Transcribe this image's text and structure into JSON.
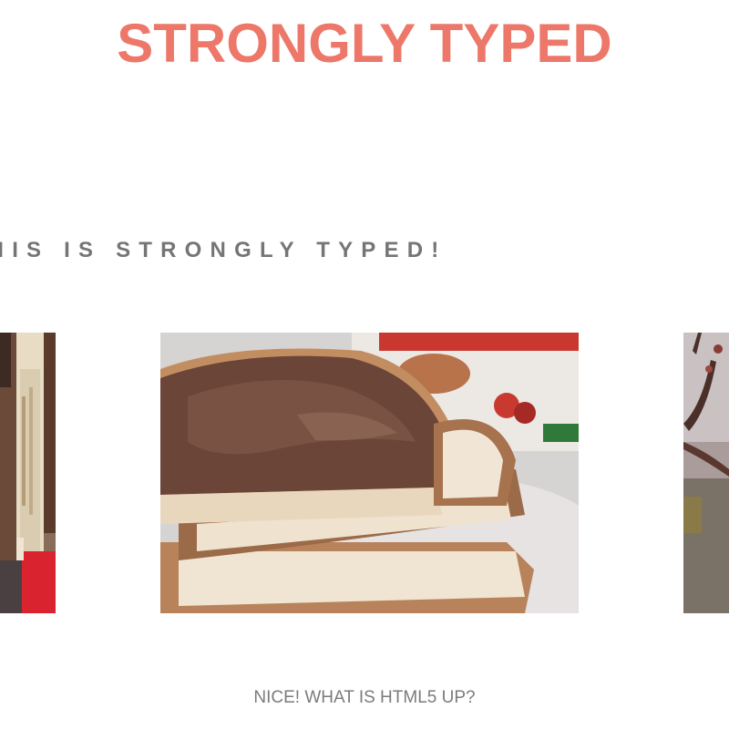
{
  "header": {
    "title": "STRONGLY TYPED"
  },
  "banner": {
    "tagline": "GENTLEMEN, BEHOLD! THIS IS STRONGLY TYPED!"
  },
  "gallery": {
    "items": [
      {
        "name": "books"
      },
      {
        "name": "nutella-toast"
      },
      {
        "name": "branch"
      }
    ]
  },
  "footer_link": {
    "label": "NICE! WHAT IS HTML5 UP?"
  },
  "colors": {
    "accent": "#ed786a",
    "text": "#757575"
  }
}
